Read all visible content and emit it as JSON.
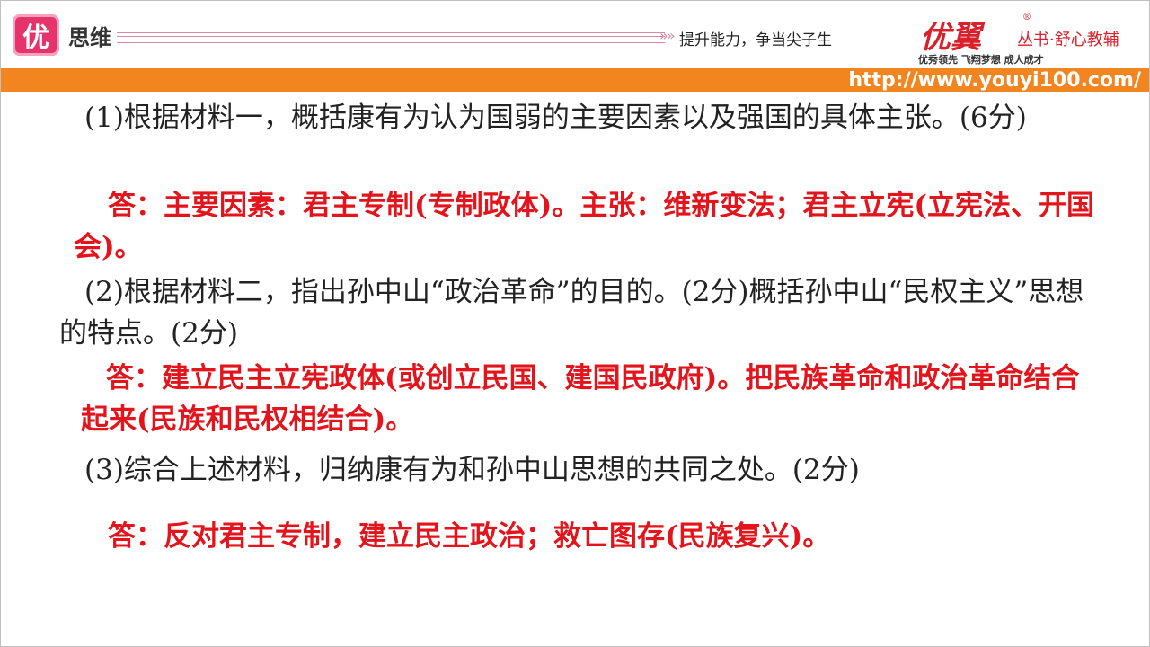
{
  "header": {
    "logo_char": "优",
    "brand_left": "思维",
    "slogan": "提升能力，争当尖子生",
    "brand_name": "优翼",
    "brand_series": "丛书·舒心教辅",
    "tagline": "优秀领先 飞翔梦想 成人成才",
    "url": "http://www.youyi100.com/",
    "colors": {
      "orange_bar": "#f2851f",
      "brand_red": "#d9202b",
      "answer_red": "#e3141b",
      "logo_pink": "#e7336b"
    }
  },
  "content": {
    "q1": "(1)根据材料一，概括康有为认为国弱的主要因素以及强国的具体主张。(6分)",
    "a1": "答：主要因素：君主专制(专制政体)。主张：维新变法；君主立宪(立宪法、开国会)。",
    "q2": "(2)根据材料二，指出孙中山“政治革命”的目的。(2分)概括孙中山“民权主义”思想的特点。(2分)",
    "a2": "答：建立民主立宪政体(或创立民国、建国民政府)。把民族革命和政治革命结合起来(民族和民权相结合)。",
    "q3": "(3)综合上述材料，归纳康有为和孙中山思想的共同之处。(2分)",
    "a3": "答：反对君主专制，建立民主政治；救亡图存(民族复兴)。"
  }
}
